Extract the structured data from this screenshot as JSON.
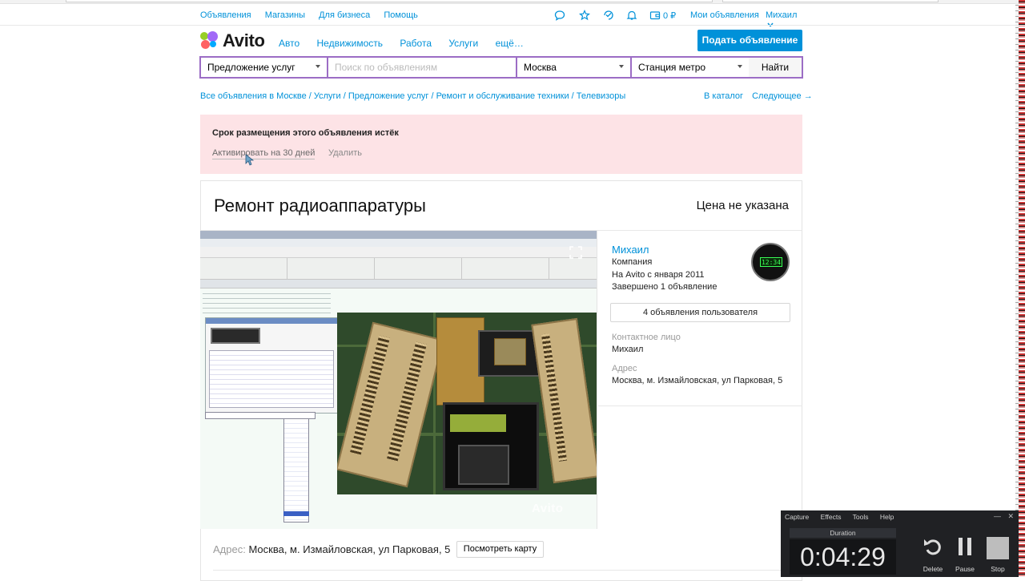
{
  "top_links": [
    "Объявления",
    "Магазины",
    "Для бизнеса",
    "Помощь"
  ],
  "header_right": {
    "wallet": "0 ₽",
    "my_ads": "Мои объявления",
    "user": "Михаил"
  },
  "logo_text": "Avito",
  "category_nav": [
    "Авто",
    "Недвижимость",
    "Работа",
    "Услуги",
    "ещё…"
  ],
  "post_ad_button": "Подать объявление",
  "search": {
    "category": "Предложение услуг",
    "placeholder": "Поиск по объявлениям",
    "city": "Москва",
    "metro": "Станция метро",
    "submit": "Найти"
  },
  "breadcrumb": "Все объявления в Москве / Услуги / Предложение услуг / Ремонт и обслуживание техники / Телевизоры",
  "breadcrumb_right": {
    "catalog": "В каталог",
    "next": "Следующее →"
  },
  "expired_banner": {
    "title": "Срок размещения этого объявления истёк",
    "activate": "Активировать на 30 дней",
    "delete": "Удалить"
  },
  "listing": {
    "title": "Ремонт радиоаппаратуры",
    "price": "Цена не указана",
    "photo_watermark": "Avito",
    "address_label": "Адрес:",
    "address": "Москва, м. Измайловская, ул Парковая, 5",
    "map_button": "Посмотреть карту"
  },
  "seller": {
    "name": "Михаил",
    "type": "Компания",
    "since": "На Avito с января 2011",
    "completed": "Завершено 1 объявление",
    "ads_button": "4 объявления пользователя",
    "contact_label": "Контактное лицо",
    "contact_name": "Михаил",
    "address_label": "Адрес",
    "address": "Москва, м. Измайловская, ул Парковая, 5",
    "avatar_clock": "12:34"
  },
  "capture_widget": {
    "menu": [
      "Capture",
      "Effects",
      "Tools",
      "Help"
    ],
    "duration_label": "Duration",
    "time": "0:04:29",
    "buttons": [
      "Delete",
      "Pause",
      "Stop"
    ]
  },
  "colors": {
    "accent": "#0091d9",
    "search_border": "#9c6dc5",
    "banner_bg": "#fde3e6"
  }
}
